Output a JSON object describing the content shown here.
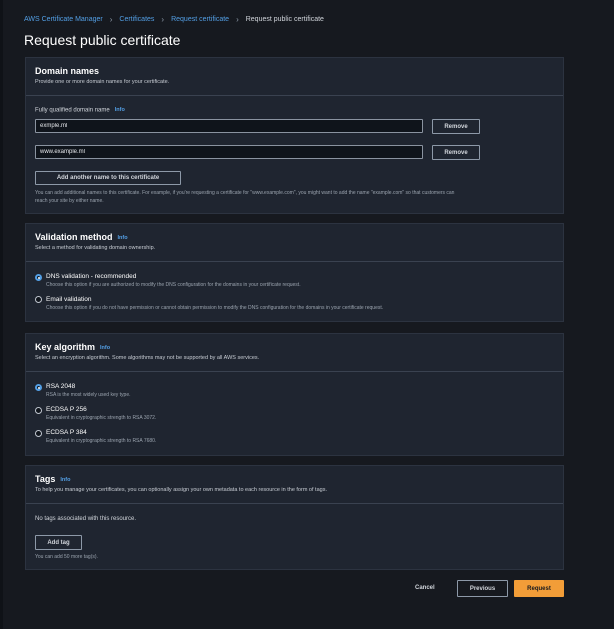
{
  "breadcrumb": {
    "items": [
      "AWS Certificate Manager",
      "Certificates",
      "Request certificate"
    ],
    "current": "Request public certificate",
    "separator": "›"
  },
  "page_title": "Request public certificate",
  "domain_names": {
    "title": "Domain names",
    "description": "Provide one or more domain names for your certificate.",
    "fqdn_label": "Fully qualified domain name",
    "info": "Info",
    "domains": [
      {
        "value": "exmple.ml",
        "remove_label": "Remove"
      },
      {
        "value": "www.example.ml",
        "remove_label": "Remove"
      }
    ],
    "add_button": "Add another name to this certificate",
    "hint_line1": "You can add additional names to this certificate. For example, if you're requesting a certificate for \"www.example.com\", you might want to add the name \"example.com\" so that customers can",
    "hint_line2": "reach your site by either name."
  },
  "validation": {
    "title": "Validation method",
    "info": "Info",
    "description": "Select a method for validating domain ownership.",
    "options": [
      {
        "label": "DNS validation - recommended",
        "desc": "Choose this option if you are authorized to modify the DNS configuration for the domains in your certificate request.",
        "selected": true
      },
      {
        "label": "Email validation",
        "desc": "Choose this option if you do not have permission or cannot obtain permission to modify the DNS configuration for the domains in your certificate request.",
        "selected": false
      }
    ]
  },
  "key_algorithm": {
    "title": "Key algorithm",
    "info": "Info",
    "description": "Select an encryption algorithm. Some algorithms may not be supported by all AWS services.",
    "options": [
      {
        "label": "RSA 2048",
        "desc": "RSA is the most widely used key type.",
        "selected": true
      },
      {
        "label": "ECDSA P 256",
        "desc": "Equivalent in cryptographic strength to RSA 3072.",
        "selected": false
      },
      {
        "label": "ECDSA P 384",
        "desc": "Equivalent in cryptographic strength to RSA 7680.",
        "selected": false
      }
    ]
  },
  "tags": {
    "title": "Tags",
    "info": "Info",
    "description": "To help you manage your certificates, you can optionally assign your own metadata to each resource in the form of tags.",
    "empty_text": "No tags associated with this resource.",
    "add_button": "Add tag",
    "limit_hint": "You can add 50 more tag(s)."
  },
  "footer": {
    "cancel": "Cancel",
    "previous": "Previous",
    "request": "Request"
  },
  "colors": {
    "background": "#16191f",
    "panel": "#1f2530",
    "link": "#539fe5",
    "primary": "#f29d38"
  }
}
